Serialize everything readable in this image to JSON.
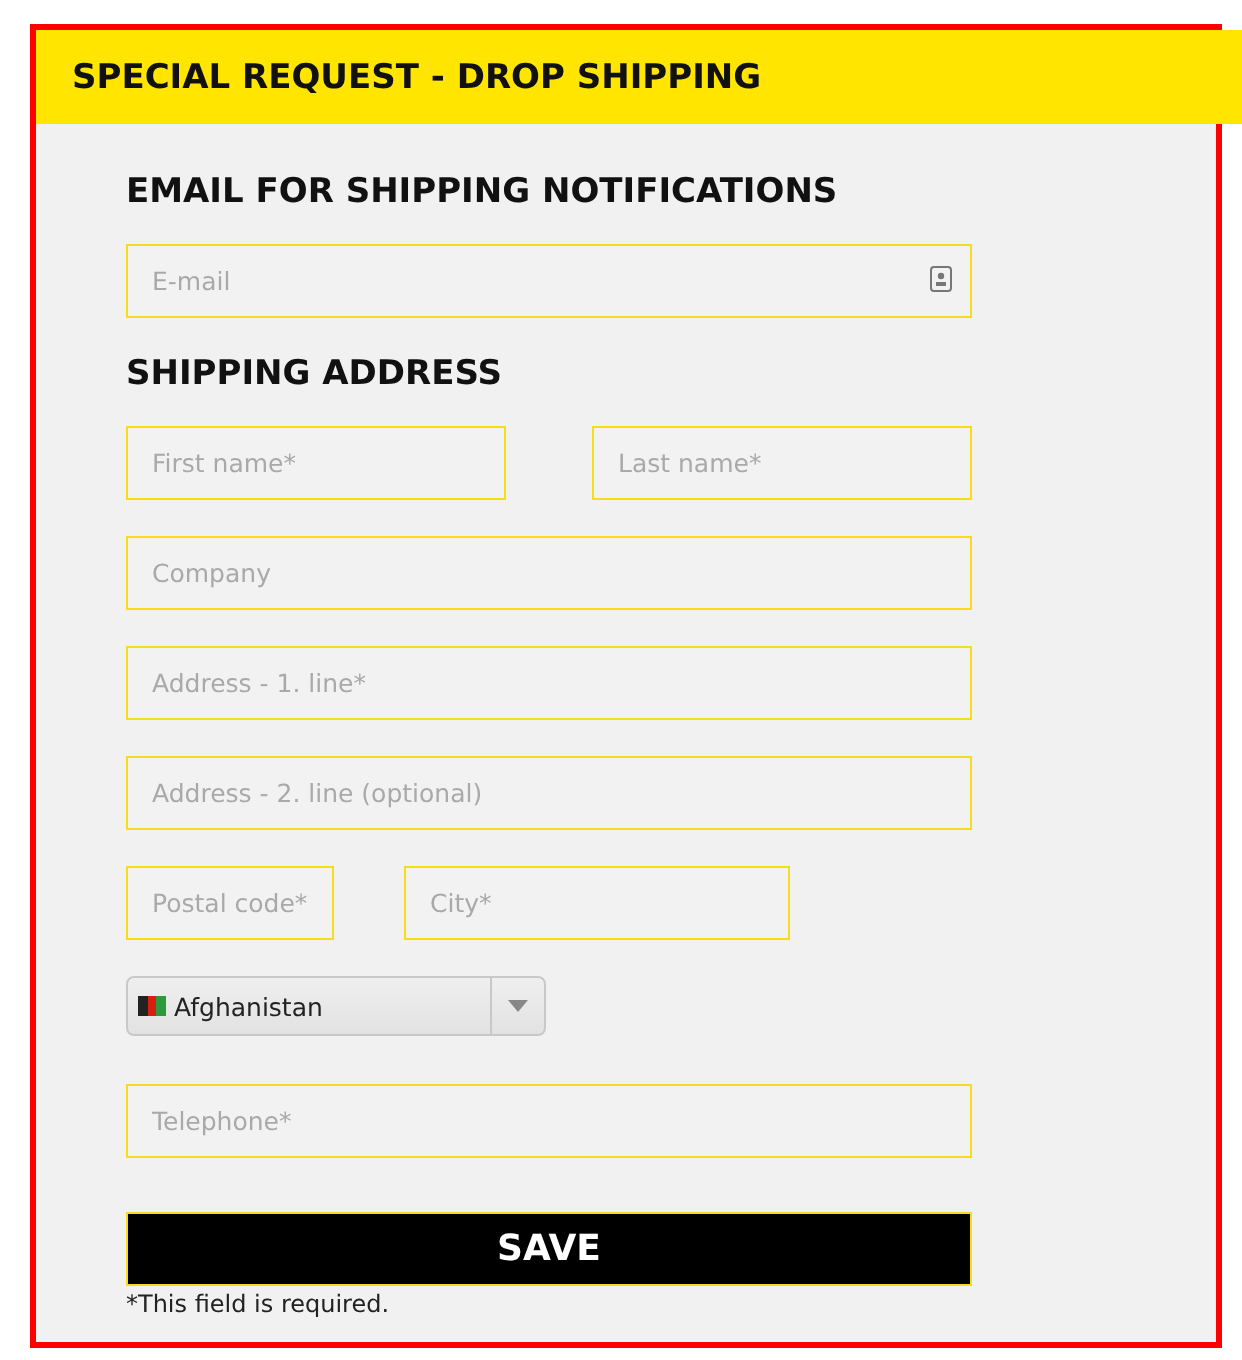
{
  "header": {
    "title": "SPECIAL REQUEST - DROP SHIPPING"
  },
  "sections": [
    {
      "heading": "EMAIL FOR SHIPPING NOTIFICATIONS",
      "rows": [
        [
          {
            "placeholder": "E-mail"
          }
        ]
      ]
    },
    {
      "heading": "SHIPPING ADDRESS",
      "rows": [
        [
          {
            "placeholder": "First name*"
          },
          {
            "placeholder": "Last name*"
          }
        ],
        [
          {
            "placeholder": "Company"
          }
        ],
        [
          {
            "placeholder": "Address - 1. line*"
          }
        ],
        [
          {
            "placeholder": "Address - 2. line (optional)"
          }
        ],
        [
          {
            "placeholder": "Postal code*"
          },
          {
            "placeholder": "City*"
          }
        ]
      ]
    }
  ],
  "country": {
    "value": "Afghanistan"
  },
  "telephone": {
    "placeholder": "Telephone*"
  },
  "save_button": "SAVE",
  "note": "*This field is required."
}
